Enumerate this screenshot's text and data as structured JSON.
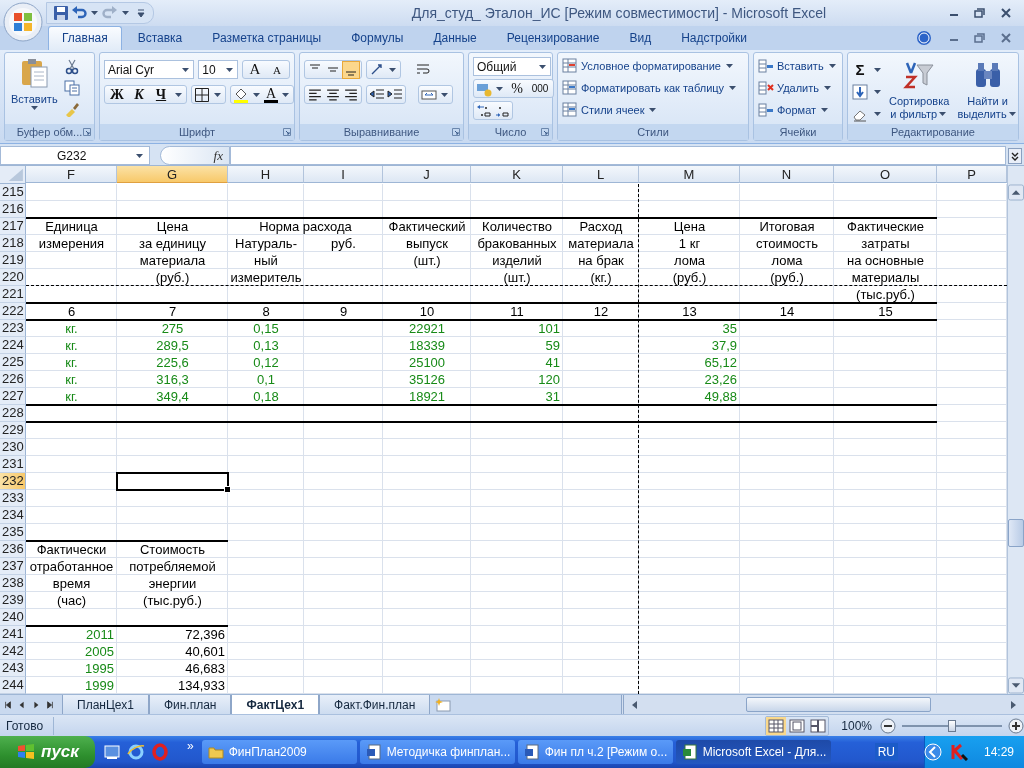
{
  "window": {
    "title": "Для_студ_ Эталон_ИС  [Режим совместимости] - Microsoft Excel"
  },
  "ribbon_tabs": [
    {
      "label": "Главная",
      "selected": true
    },
    {
      "label": "Вставка",
      "selected": false
    },
    {
      "label": "Разметка страницы",
      "selected": false
    },
    {
      "label": "Формулы",
      "selected": false
    },
    {
      "label": "Данные",
      "selected": false
    },
    {
      "label": "Рецензирование",
      "selected": false
    },
    {
      "label": "Вид",
      "selected": false
    },
    {
      "label": "Надстройки",
      "selected": false
    }
  ],
  "clipboard": {
    "paste": "Вставить",
    "label": "Буфер обм..."
  },
  "font": {
    "name": "Arial Cyr",
    "size": "10",
    "grow": "A",
    "shrink": "A",
    "bold": "Ж",
    "italic": "К",
    "underline": "Ч",
    "font_color": "A",
    "label": "Шрифт"
  },
  "alignment": {
    "vertical": [
      {
        "kind": "top",
        "selected": false
      },
      {
        "kind": "middle",
        "selected": false
      },
      {
        "kind": "bottom",
        "selected": true
      }
    ],
    "horizontal": [
      {
        "kind": "left",
        "selected": false
      },
      {
        "kind": "center",
        "selected": false
      },
      {
        "kind": "right",
        "selected": false
      }
    ],
    "label": "Выравнивание"
  },
  "number": {
    "format": "Общий",
    "percent": "%",
    "thousands": "000",
    "label": "Число"
  },
  "styles": {
    "items": [
      "Условное форматирование",
      "Форматировать как таблицу",
      "Стили ячеек"
    ],
    "label": "Стили"
  },
  "cells": {
    "items": [
      "Вставить",
      "Удалить",
      "Формат"
    ],
    "label": "Ячейки"
  },
  "editing": {
    "sum": "Σ",
    "sort": [
      "Сортировка",
      "и фильтр"
    ],
    "find": [
      "Найти и",
      "выделить"
    ],
    "label": "Редактирование"
  },
  "formula_bar": {
    "name_box": "G232",
    "fx": "fx"
  },
  "sheet": {
    "columns": [
      {
        "letter": "F",
        "selected": false,
        "page_break": false
      },
      {
        "letter": "G",
        "selected": true,
        "page_break": false
      },
      {
        "letter": "H",
        "selected": false,
        "page_break": false
      },
      {
        "letter": "I",
        "selected": false,
        "page_break": false
      },
      {
        "letter": "J",
        "selected": false,
        "page_break": false
      },
      {
        "letter": "K",
        "selected": false,
        "page_break": false
      },
      {
        "letter": "L",
        "selected": false,
        "page_break": true
      },
      {
        "letter": "M",
        "selected": false,
        "page_break": false
      },
      {
        "letter": "N",
        "selected": false,
        "page_break": false
      },
      {
        "letter": "O",
        "selected": false,
        "page_break": false
      },
      {
        "letter": "P",
        "selected": false,
        "page_break": false
      }
    ],
    "rows": [
      {
        "n": "215",
        "kind": "plain",
        "selected": false,
        "page_break": false
      },
      {
        "n": "216",
        "kind": "plain",
        "selected": false,
        "page_break": false
      },
      {
        "n": "217",
        "kind": "wide",
        "selected": false,
        "page_break": false,
        "cells": {
          "F": {
            "text": "Единица",
            "kind": "label"
          },
          "G": {
            "text": "Цена",
            "kind": "label"
          },
          "H": {
            "text": "Норма расхода",
            "kind": "label",
            "merged": true
          },
          "J": {
            "text": "Фактический",
            "kind": "label"
          },
          "K": {
            "text": "Количество",
            "kind": "label"
          },
          "L": {
            "text": "Расход",
            "kind": "label"
          },
          "M": {
            "text": "Цена",
            "kind": "label"
          },
          "N": {
            "text": "Итоговая",
            "kind": "label"
          },
          "O": {
            "text": "Фактические",
            "kind": "label"
          }
        }
      },
      {
        "n": "218",
        "kind": "plain",
        "selected": false,
        "page_break": false,
        "cells": {
          "F": {
            "text": "измерения",
            "kind": "label"
          },
          "G": {
            "text": "за единицу",
            "kind": "label"
          },
          "H": {
            "text": "Натураль-",
            "kind": "label"
          },
          "I": {
            "text": "руб.",
            "kind": "label"
          },
          "J": {
            "text": "выпуск",
            "kind": "label"
          },
          "K": {
            "text": "бракованных",
            "kind": "label"
          },
          "L": {
            "text": "материала",
            "kind": "label"
          },
          "M": {
            "text": "1 кг",
            "kind": "label"
          },
          "N": {
            "text": "стоимость",
            "kind": "label"
          },
          "O": {
            "text": "затраты",
            "kind": "label"
          }
        }
      },
      {
        "n": "219",
        "kind": "plain",
        "selected": false,
        "page_break": false,
        "cells": {
          "G": {
            "text": "материала",
            "kind": "label"
          },
          "H": {
            "text": "ный",
            "kind": "label"
          },
          "J": {
            "text": "(шт.)",
            "kind": "label"
          },
          "K": {
            "text": "изделий",
            "kind": "label"
          },
          "L": {
            "text": "на брак",
            "kind": "label"
          },
          "M": {
            "text": "лома",
            "kind": "label"
          },
          "N": {
            "text": "лома",
            "kind": "label"
          },
          "O": {
            "text": "на основные",
            "kind": "label"
          }
        }
      },
      {
        "n": "220",
        "kind": "plain",
        "selected": false,
        "page_break": true,
        "cells": {
          "G": {
            "text": "(руб.)",
            "kind": "label"
          },
          "H": {
            "text": "измеритель",
            "kind": "label"
          },
          "K": {
            "text": "(шт.)",
            "kind": "label"
          },
          "L": {
            "text": "(кг.)",
            "kind": "label"
          },
          "M": {
            "text": "(руб.)",
            "kind": "label"
          },
          "N": {
            "text": "(руб.)",
            "kind": "label"
          },
          "O": {
            "text": "материалы",
            "kind": "label"
          }
        }
      },
      {
        "n": "221",
        "kind": "plain",
        "selected": false,
        "page_break": false,
        "cells": {
          "O": {
            "text": "(тыс.руб.)",
            "kind": "label"
          }
        }
      },
      {
        "n": "222",
        "kind": "wide",
        "selected": false,
        "page_break": false,
        "cells": {
          "F": {
            "text": "6",
            "kind": "label"
          },
          "G": {
            "text": "7",
            "kind": "label"
          },
          "H": {
            "text": "8",
            "kind": "label"
          },
          "I": {
            "text": "9",
            "kind": "label"
          },
          "J": {
            "text": "10",
            "kind": "label"
          },
          "K": {
            "text": "11",
            "kind": "label"
          },
          "L": {
            "text": "12",
            "kind": "label"
          },
          "M": {
            "text": "13",
            "kind": "label"
          },
          "N": {
            "text": "14",
            "kind": "label"
          },
          "O": {
            "text": "15",
            "kind": "label"
          }
        }
      },
      {
        "n": "223",
        "kind": "wide",
        "selected": false,
        "page_break": false,
        "cells": {
          "F": {
            "text": "кг.",
            "kind": "entry"
          },
          "G": {
            "text": "275",
            "kind": "entry"
          },
          "H": {
            "text": "0,15",
            "kind": "entry"
          },
          "J": {
            "text": "22921",
            "kind": "entry"
          },
          "K": {
            "text": "101",
            "kind": "amount"
          },
          "M": {
            "text": "35",
            "kind": "amount"
          }
        }
      },
      {
        "n": "224",
        "kind": "plain",
        "selected": false,
        "page_break": false,
        "cells": {
          "F": {
            "text": "кг.",
            "kind": "entry"
          },
          "G": {
            "text": "289,5",
            "kind": "entry"
          },
          "H": {
            "text": "0,13",
            "kind": "entry"
          },
          "J": {
            "text": "18339",
            "kind": "entry"
          },
          "K": {
            "text": "59",
            "kind": "amount"
          },
          "M": {
            "text": "37,9",
            "kind": "amount"
          }
        }
      },
      {
        "n": "225",
        "kind": "plain",
        "selected": false,
        "page_break": false,
        "cells": {
          "F": {
            "text": "кг.",
            "kind": "entry"
          },
          "G": {
            "text": "225,6",
            "kind": "entry"
          },
          "H": {
            "text": "0,12",
            "kind": "entry"
          },
          "J": {
            "text": "25100",
            "kind": "entry"
          },
          "K": {
            "text": "41",
            "kind": "amount"
          },
          "M": {
            "text": "65,12",
            "kind": "amount"
          }
        }
      },
      {
        "n": "226",
        "kind": "plain",
        "selected": false,
        "page_break": false,
        "cells": {
          "F": {
            "text": "кг.",
            "kind": "entry"
          },
          "G": {
            "text": "316,3",
            "kind": "entry"
          },
          "H": {
            "text": "0,1",
            "kind": "entry"
          },
          "J": {
            "text": "35126",
            "kind": "entry"
          },
          "K": {
            "text": "120",
            "kind": "amount"
          },
          "M": {
            "text": "23,26",
            "kind": "amount"
          }
        }
      },
      {
        "n": "227",
        "kind": "plain",
        "selected": false,
        "page_break": false,
        "cells": {
          "F": {
            "text": "кг.",
            "kind": "entry"
          },
          "G": {
            "text": "349,4",
            "kind": "entry"
          },
          "H": {
            "text": "0,18",
            "kind": "entry"
          },
          "J": {
            "text": "18921",
            "kind": "entry"
          },
          "K": {
            "text": "31",
            "kind": "amount"
          },
          "M": {
            "text": "49,88",
            "kind": "amount"
          }
        }
      },
      {
        "n": "228",
        "kind": "wide",
        "selected": false,
        "page_break": false
      },
      {
        "n": "229",
        "kind": "wide",
        "selected": false,
        "page_break": false
      },
      {
        "n": "230",
        "kind": "plain",
        "selected": false,
        "page_break": false
      },
      {
        "n": "231",
        "kind": "plain",
        "selected": false,
        "page_break": false
      },
      {
        "n": "232",
        "kind": "plain",
        "selected": true,
        "page_break": false
      },
      {
        "n": "233",
        "kind": "plain",
        "selected": false,
        "page_break": false
      },
      {
        "n": "234",
        "kind": "plain",
        "selected": false,
        "page_break": false
      },
      {
        "n": "235",
        "kind": "plain",
        "selected": false,
        "page_break": false
      },
      {
        "n": "236",
        "kind": "narrow",
        "selected": false,
        "page_break": false,
        "cells": {
          "F": {
            "text": "Фактически",
            "kind": "label"
          },
          "G": {
            "text": "Стоимость",
            "kind": "label"
          }
        }
      },
      {
        "n": "237",
        "kind": "plain",
        "selected": false,
        "page_break": false,
        "cells": {
          "F": {
            "text": "отработанное",
            "kind": "label"
          },
          "G": {
            "text": "потребляемой",
            "kind": "label"
          }
        }
      },
      {
        "n": "238",
        "kind": "plain",
        "selected": false,
        "page_break": false,
        "cells": {
          "F": {
            "text": "время",
            "kind": "label"
          },
          "G": {
            "text": "энергии",
            "kind": "label"
          }
        }
      },
      {
        "n": "239",
        "kind": "plain",
        "selected": false,
        "page_break": false,
        "cells": {
          "F": {
            "text": "(час)",
            "kind": "label"
          },
          "G": {
            "text": "(тыс.руб.)",
            "kind": "label"
          }
        }
      },
      {
        "n": "240",
        "kind": "plain",
        "selected": false,
        "page_break": false
      },
      {
        "n": "241",
        "kind": "narrow",
        "selected": false,
        "page_break": false,
        "cells": {
          "F": {
            "text": "2011",
            "kind": "amount"
          },
          "G": {
            "text": "72,396",
            "kind": "total"
          }
        }
      },
      {
        "n": "242",
        "kind": "plain",
        "selected": false,
        "page_break": false,
        "cells": {
          "F": {
            "text": "2005",
            "kind": "amount"
          },
          "G": {
            "text": "40,601",
            "kind": "total"
          }
        }
      },
      {
        "n": "243",
        "kind": "plain",
        "selected": false,
        "page_break": false,
        "cells": {
          "F": {
            "text": "1995",
            "kind": "amount"
          },
          "G": {
            "text": "46,683",
            "kind": "total"
          }
        }
      },
      {
        "n": "244",
        "kind": "plain",
        "selected": false,
        "page_break": false,
        "cells": {
          "F": {
            "text": "1999",
            "kind": "amount"
          },
          "G": {
            "text": "134,933",
            "kind": "total"
          }
        }
      }
    ]
  },
  "sheet_tabs": [
    {
      "label": "ПланЦех1",
      "selected": false
    },
    {
      "label": "Фин.план",
      "selected": false
    },
    {
      "label": "ФактЦех1",
      "selected": true
    },
    {
      "label": "Факт.Фин.план",
      "selected": false
    }
  ],
  "status_bar": {
    "status": "Готово",
    "views": [
      {
        "kind": "normal",
        "selected": true
      },
      {
        "kind": "layout",
        "selected": false
      },
      {
        "kind": "breaks",
        "selected": false
      }
    ],
    "zoom": "100%",
    "zoom_slider": {
      "level": 0.5
    }
  },
  "taskbar": {
    "start": "пуск",
    "more": "»",
    "tasks": [
      {
        "label": "ФинПлан2009",
        "kind": "folder",
        "selected": false
      },
      {
        "label": "Методичка финплан...",
        "kind": "word",
        "selected": false
      },
      {
        "label": "Фин пл ч.2 [Режим о...",
        "kind": "word",
        "selected": false
      },
      {
        "label": "Microsoft Excel - Для...",
        "kind": "excel",
        "selected": true
      }
    ],
    "language": "RU",
    "clock": "14:29"
  }
}
